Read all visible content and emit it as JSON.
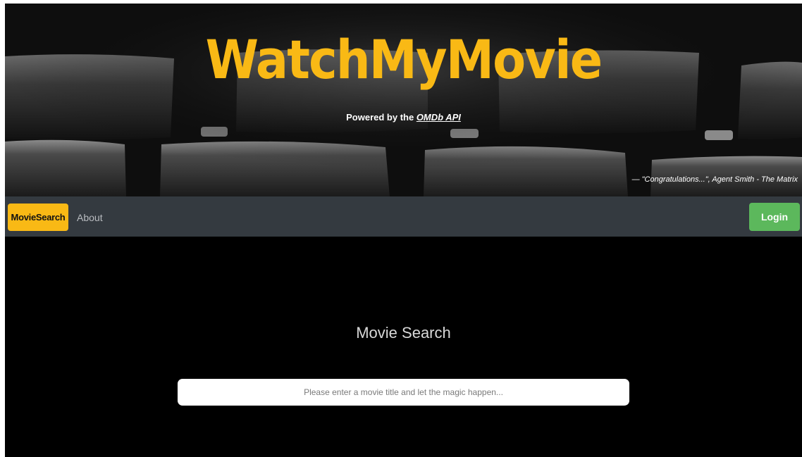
{
  "hero": {
    "title": "WatchMyMovie",
    "subtitle_prefix": "Powered by the ",
    "subtitle_link": "OMDb API",
    "quote": "— \"Congratulations...\", Agent Smith - The Matrix"
  },
  "navbar": {
    "brand": "MovieSearch",
    "about": "About",
    "login": "Login"
  },
  "main": {
    "heading": "Movie Search",
    "search_placeholder": "Please enter a movie title and let the magic happen...",
    "search_value": ""
  },
  "colors": {
    "accent": "#f9b915",
    "navbar_bg": "#343a40",
    "login_bg": "#5cb85c",
    "page_bg": "#000000"
  }
}
